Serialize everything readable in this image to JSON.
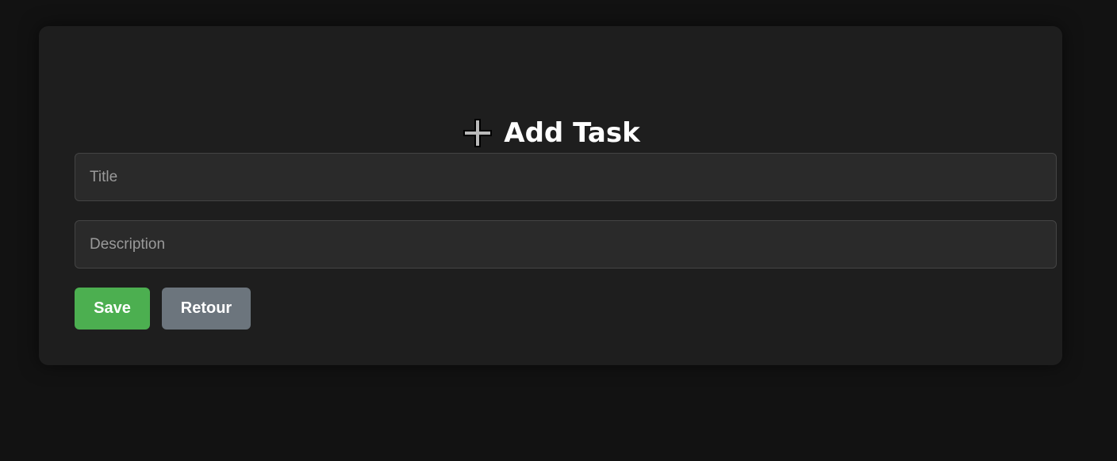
{
  "form": {
    "heading": "Add Task",
    "heading_icon": "plus-icon",
    "title_placeholder": "Title",
    "title_value": "",
    "description_placeholder": "Description",
    "description_value": "",
    "save_label": "Save",
    "back_label": "Retour"
  },
  "colors": {
    "page_background": "#121212",
    "card_background": "#1e1e1e",
    "input_background": "#2a2a2a",
    "save_button": "#4caf50",
    "back_button": "#6c757d",
    "text": "#ffffff"
  }
}
